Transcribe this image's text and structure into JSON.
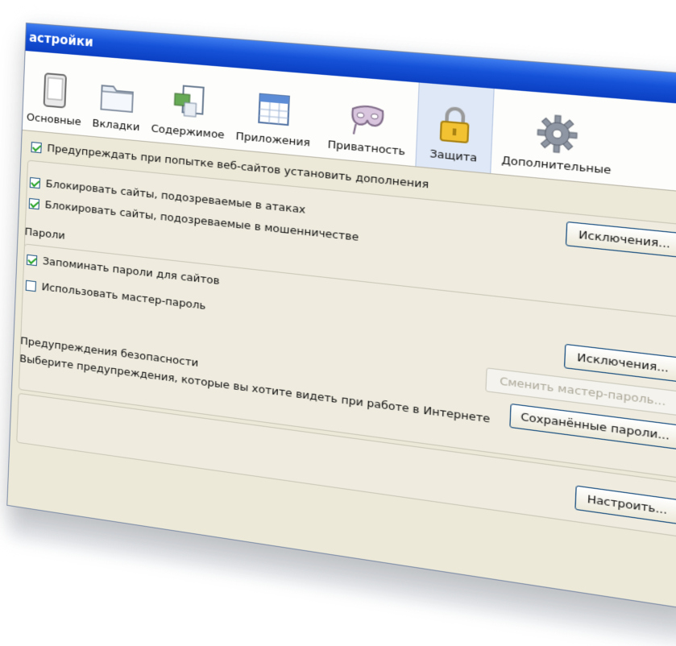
{
  "window": {
    "title": "астройки",
    "close_glyph": "x"
  },
  "tabs": [
    {
      "label": "Основные",
      "icon": "phone-icon"
    },
    {
      "label": "Вкладки",
      "icon": "folder-icon"
    },
    {
      "label": "Содержимое",
      "icon": "content-icon"
    },
    {
      "label": "Приложения",
      "icon": "calendar-icon"
    },
    {
      "label": "Приватность",
      "icon": "mask-icon"
    },
    {
      "label": "Защита",
      "icon": "lock-icon",
      "selected": true
    },
    {
      "label": "Дополнительные",
      "icon": "gear-icon"
    }
  ],
  "addons": {
    "warn_label": "Предупреждать при попытке веб-сайтов установить дополнения",
    "warn_checked": true,
    "exceptions_label": "Исключения..."
  },
  "blocking": {
    "attack_label": "Блокировать сайты, подозреваемые в атаках",
    "attack_checked": true,
    "forgery_label": "Блокировать сайты, подозреваемые в мошенничестве",
    "forgery_checked": true
  },
  "passwords": {
    "section_title": "Пароли",
    "remember_label": "Запоминать пароли для сайтов",
    "remember_checked": true,
    "master_label": "Использовать мастер-пароль",
    "master_checked": false,
    "exceptions_label": "Исключения...",
    "change_master_label": "Сменить мастер-пароль...",
    "saved_passwords_label": "Сохранённые пароли..."
  },
  "security_warnings": {
    "section_title": "Предупреждения безопасности",
    "description": "Выберите предупреждения, которые вы хотите видеть при работе в Интернете",
    "configure_label": "Настроить..."
  },
  "colors": {
    "titlebar": "#1552d8",
    "dialog_bg": "#ece9d8",
    "check": "#21a121"
  }
}
